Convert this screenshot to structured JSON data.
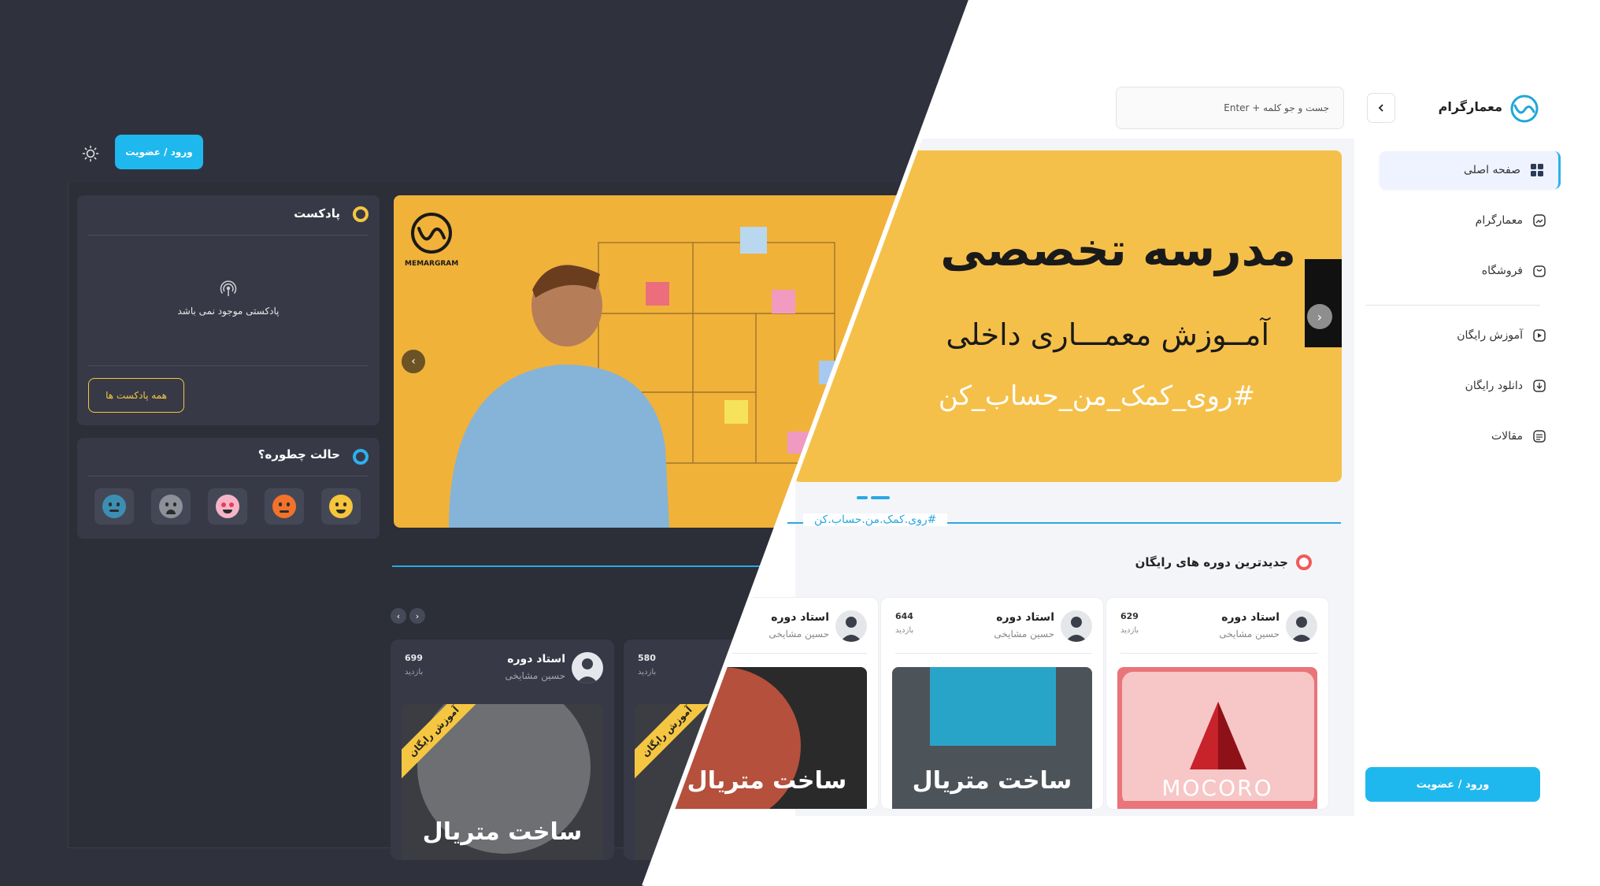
{
  "brand": {
    "name": "معمارگرام",
    "hero_logo_text": "MEMARGRAM"
  },
  "search": {
    "placeholder": "جست و جو کلمه + Enter"
  },
  "sidebar": {
    "items": [
      {
        "label": "صفحه اصلی",
        "icon": "grid-icon",
        "active": true
      },
      {
        "label": "معمارگرام",
        "icon": "gallery-icon",
        "active": false
      },
      {
        "label": "فروشگاه",
        "icon": "shopping-bag-icon",
        "active": false
      },
      {
        "label": "آموزش رایگان",
        "icon": "play-icon",
        "active": false
      },
      {
        "label": "دانلود رایگان",
        "icon": "download-icon",
        "active": false
      },
      {
        "label": "مقالات",
        "icon": "article-icon",
        "active": false
      }
    ],
    "login_label": "ورود / عضویت"
  },
  "hero": {
    "title": "مدرسه تخصصی",
    "subtitle": "آمــوزش معمـــاری داخلی",
    "hashtag": "#روی_کمک_من_حساب_کن"
  },
  "hashtag_divider": "#روی.کمک.من.حساب.کن",
  "section": {
    "title": "جدیدترین دوره های رایگان"
  },
  "cards": [
    {
      "title": "استاد دوره",
      "teacher": "حسین مشایخی",
      "views": "629",
      "views_label": "بازدید",
      "image_text": "MOCORO"
    },
    {
      "title": "استاد دوره",
      "teacher": "حسین مشایخی",
      "views": "644",
      "views_label": "بازدید",
      "image_text": "ساخت متریال"
    },
    {
      "title": "استاد دوره",
      "teacher": "حسین مشایخی",
      "views": "",
      "views_label": "",
      "image_text": "ساخت متریال"
    }
  ],
  "dark": {
    "login_label": "ورود / عضویت",
    "podcast": {
      "title": "پادکست",
      "empty": "پادکستی موجود نمی باشد",
      "all_button": "همه پادکست ها"
    },
    "mood": {
      "title": "حالت چطوره؟",
      "faces": [
        "happy",
        "angry",
        "love",
        "crying",
        "neutral"
      ]
    },
    "cards": [
      {
        "title": "استاد دوره",
        "teacher": "حسین مشایخی",
        "views": "699",
        "views_label": "بازدید",
        "ribbon": "آموزش رایگان",
        "image_text": "ساخت متریال"
      },
      {
        "title": "",
        "teacher": "",
        "views": "580",
        "views_label": "بازدید",
        "ribbon": "آموزش رایگان",
        "image_text": ""
      }
    ]
  },
  "colors": {
    "accent": "#1fb8ee",
    "hero_yellow": "#f5c04a",
    "dark_bg": "#2f323d",
    "podcast_yellow": "#f5c642",
    "section_red": "#f05a5a"
  }
}
